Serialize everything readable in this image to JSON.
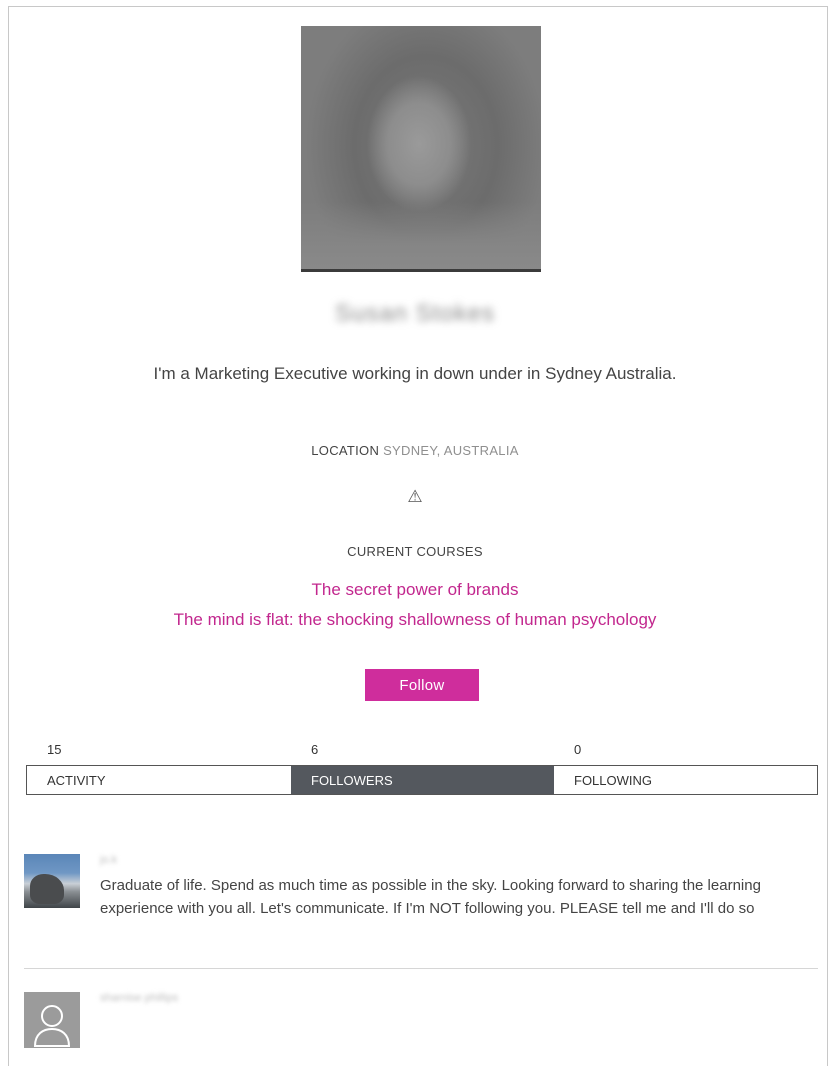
{
  "profile": {
    "name": "Susan Stokes",
    "bio": "I'm a Marketing Executive working in down under in Sydney Australia.",
    "location_label": "LOCATION",
    "location_value": "SYDNEY, AUSTRALIA",
    "warning_icon": "⚠",
    "courses_heading": "CURRENT COURSES",
    "courses": [
      "The secret power of brands",
      "The mind is flat: the shocking shallowness of human psychology"
    ],
    "follow_label": "Follow"
  },
  "stats": {
    "activity_count": "15",
    "followers_count": "6",
    "following_count": "0"
  },
  "tabs": {
    "activity": "ACTIVITY",
    "followers": "FOLLOWERS",
    "following": "FOLLOWING",
    "active": "followers"
  },
  "followers": [
    {
      "name": "jo.k",
      "bio": "Graduate of life. Spend as much time as possible in the sky. Looking forward to sharing the learning experience with you all. Let's communicate. If I'm NOT following you. PLEASE tell me and I'll do so"
    },
    {
      "name": "sharnise phillips",
      "bio": ""
    }
  ],
  "colors": {
    "accent": "#c2278e",
    "button": "#cf2d9c",
    "active_tab": "#54585e"
  }
}
